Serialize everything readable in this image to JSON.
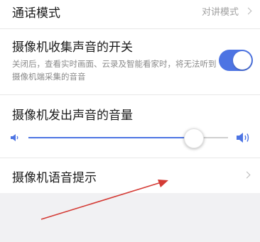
{
  "call_mode": {
    "title": "通话模式",
    "value": "对讲模式"
  },
  "sound_capture": {
    "title": "摄像机收集声音的开关",
    "description": "关闭后，查看实时画面、云录及智能看家时，将无法听到摄像机端采集的音音",
    "enabled": true
  },
  "volume": {
    "title": "摄像机发出声音的音量",
    "level_percent": 86
  },
  "voice_prompt": {
    "title": "摄像机语音提示"
  },
  "colors": {
    "accent": "#4d74e3",
    "arrow": "#d43b35"
  }
}
